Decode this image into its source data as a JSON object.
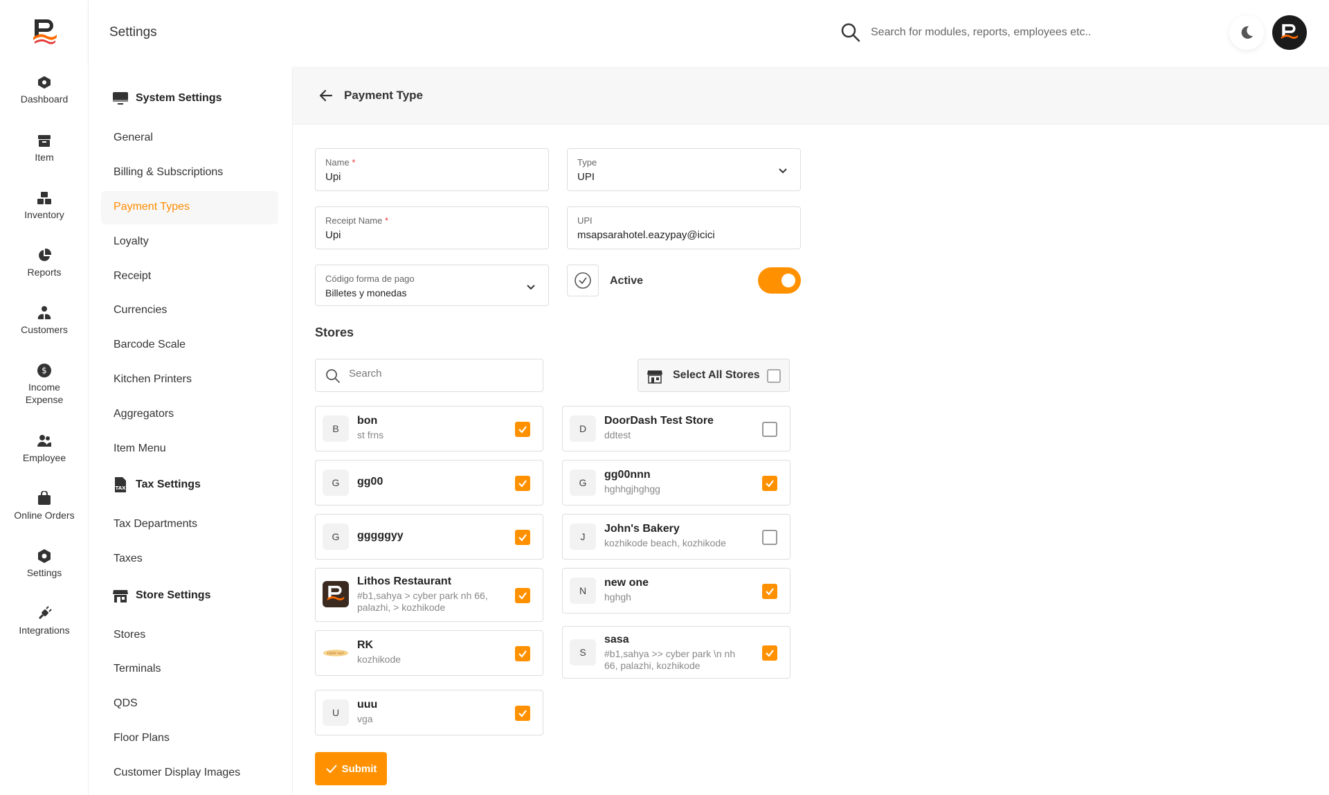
{
  "header": {
    "title": "Settings",
    "search_placeholder": "Search for modules, reports, employees etc.."
  },
  "nav": [
    {
      "label": "Dashboard",
      "icon": "dashboard-icon"
    },
    {
      "label": "Item",
      "icon": "item-icon"
    },
    {
      "label": "Inventory",
      "icon": "inventory-icon"
    },
    {
      "label": "Reports",
      "icon": "reports-icon"
    },
    {
      "label": "Customers",
      "icon": "customers-icon"
    },
    {
      "label": "Income Expense",
      "icon": "income-expense-icon"
    },
    {
      "label": "Employee",
      "icon": "employee-icon"
    },
    {
      "label": "Online Orders",
      "icon": "online-orders-icon"
    },
    {
      "label": "Settings",
      "icon": "settings-icon"
    },
    {
      "label": "Integrations",
      "icon": "integrations-icon"
    }
  ],
  "settings_menu": {
    "system_title": "System Settings",
    "system_items": [
      "General",
      "Billing & Subscriptions",
      "Payment Types",
      "Loyalty",
      "Receipt",
      "Currencies",
      "Barcode Scale",
      "Kitchen Printers",
      "Aggregators",
      "Item Menu"
    ],
    "tax_title": "Tax Settings",
    "tax_items": [
      "Tax Departments",
      "Taxes"
    ],
    "store_title": "Store Settings",
    "store_items": [
      "Stores",
      "Terminals",
      "QDS",
      "Floor Plans",
      "Customer Display Images"
    ],
    "active_item": "Payment Types"
  },
  "form": {
    "page_title": "Payment Type",
    "name_label": "Name",
    "name_value": "Upi",
    "type_label": "Type",
    "type_value": "UPI",
    "receipt_label": "Receipt Name",
    "receipt_value": "Upi",
    "upi_label": "UPI",
    "upi_value": "msapsarahotel.eazypay@icici",
    "codigo_label": "Código forma de pago",
    "codigo_value": "Billetes y monedas",
    "active_label": "Active",
    "active_on": true,
    "required_mark": "*"
  },
  "stores": {
    "title": "Stores",
    "search_placeholder": "Search",
    "select_all_label": "Select All Stores",
    "list": [
      {
        "initial": "B",
        "name": "bon",
        "address": "st frns",
        "checked": true
      },
      {
        "initial": "D",
        "name": "DoorDash Test Store",
        "address": "ddtest",
        "checked": false
      },
      {
        "initial": "G",
        "name": "gg00",
        "address": "",
        "checked": true
      },
      {
        "initial": "G",
        "name": "gg00nnn",
        "address": "hghhgjhghgg",
        "checked": true
      },
      {
        "initial": "G",
        "name": "gggggyy",
        "address": "",
        "checked": true
      },
      {
        "initial": "J",
        "name": "John's Bakery",
        "address": "kozhikode beach, kozhikode",
        "checked": false
      },
      {
        "initial": "",
        "name": "Lithos Restaurant",
        "address": "#b1,sahya > cyber park nh 66, palazhi, > kozhikode",
        "checked": true
      },
      {
        "initial": "N",
        "name": "new one",
        "address": "hghgh",
        "checked": true
      },
      {
        "initial": "",
        "name": "RK",
        "address": "kozhikode",
        "checked": true
      },
      {
        "initial": "S",
        "name": "sasa",
        "address": "#b1,sahya >> cyber park \\n nh 66, palazhi, kozhikode",
        "checked": true
      },
      {
        "initial": "U",
        "name": "uuu",
        "address": "vga",
        "checked": true
      }
    ]
  },
  "rk_logo_text": "FIERY HUT",
  "submit_label": "Submit",
  "colors": {
    "accent": "#ff9100",
    "text": "#222222"
  }
}
